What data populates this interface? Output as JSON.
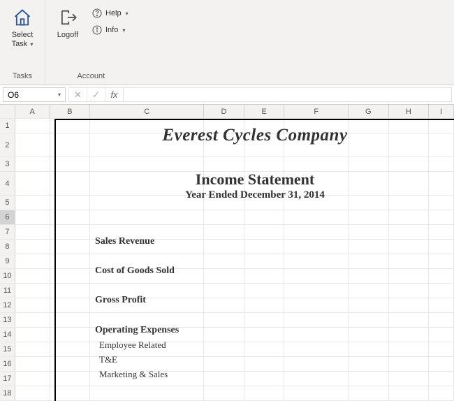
{
  "ribbon": {
    "tasks": {
      "group_label": "Tasks",
      "select_task": "Select Task"
    },
    "account": {
      "group_label": "Account",
      "logoff": "Logoff",
      "help": "Help",
      "info": "Info"
    }
  },
  "formula_bar": {
    "name_box": "O6",
    "cancel": "✕",
    "enter": "✓",
    "fx": "fx",
    "value": ""
  },
  "columns": [
    "A",
    "B",
    "C",
    "D",
    "E",
    "F",
    "G",
    "H",
    "I"
  ],
  "rows": [
    "1",
    "2",
    "3",
    "4",
    "5",
    "6",
    "7",
    "8",
    "9",
    "10",
    "11",
    "12",
    "13",
    "14",
    "15",
    "16",
    "17",
    "18"
  ],
  "tall_rows": [
    "2",
    "4"
  ],
  "selected_row": "6",
  "document": {
    "company": "Everest Cycles Company",
    "title": "Income Statement",
    "period": "Year Ended December 31, 2014",
    "lines": {
      "sales_revenue": "Sales Revenue",
      "cogs": "Cost of Goods Sold",
      "gross_profit": "Gross Profit",
      "opex": "Operating Expenses",
      "employee": "Employee Related",
      "te": "T&E",
      "marketing": "Marketing & Sales"
    }
  }
}
